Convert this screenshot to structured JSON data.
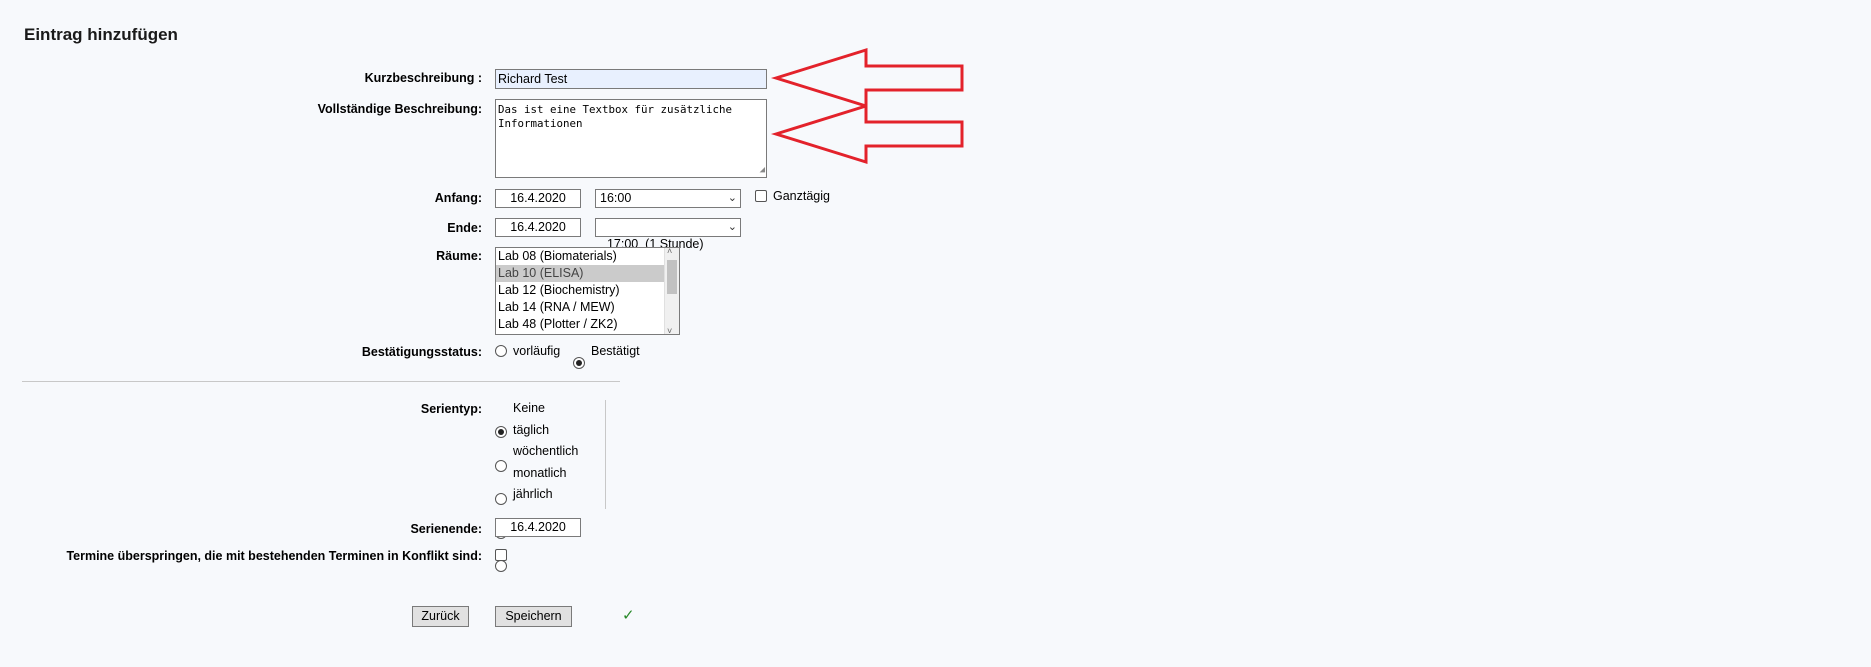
{
  "page": {
    "title": "Eintrag hinzufügen"
  },
  "form": {
    "kurz_label": "Kurzbeschreibung :",
    "kurz_value": "Richard Test",
    "voll_label": "Vollständige Beschreibung:",
    "voll_value_line1": "Das ist eine Textbox für zusätzliche",
    "voll_value_line2": "Informationen",
    "anfang_label": "Anfang:",
    "anfang_date": "16.4.2020",
    "anfang_time": "16:00",
    "ganztaegig_label": "Ganztägig",
    "ende_label": "Ende:",
    "ende_date": "16.4.2020",
    "ende_time": "17:00  (1 Stunde)",
    "raeume_label": "Räume:",
    "raeume": [
      "Lab 08 (Biomaterials)",
      "Lab 10 (ELISA)",
      "Lab 12 (Biochemistry)",
      "Lab 14 (RNA / MEW)",
      "Lab 48 (Plotter / ZK2)"
    ],
    "status_label": "Bestätigungsstatus:",
    "status_vorlaeufig": "vorläufig",
    "status_bestaetigt": "Bestätigt"
  },
  "serie": {
    "typ_label": "Serientyp:",
    "options": [
      "Keine",
      "täglich",
      "wöchentlich",
      "monatlich",
      "jährlich"
    ],
    "ende_label": "Serienende:",
    "ende_date": "16.4.2020",
    "skip_label": "Termine überspringen, die mit bestehenden Terminen in Konflikt sind:"
  },
  "buttons": {
    "back": "Zurück",
    "save": "Speichern",
    "check": "✓"
  },
  "colors": {
    "arrow": "#e3222b",
    "check": "#2a8a2a"
  }
}
